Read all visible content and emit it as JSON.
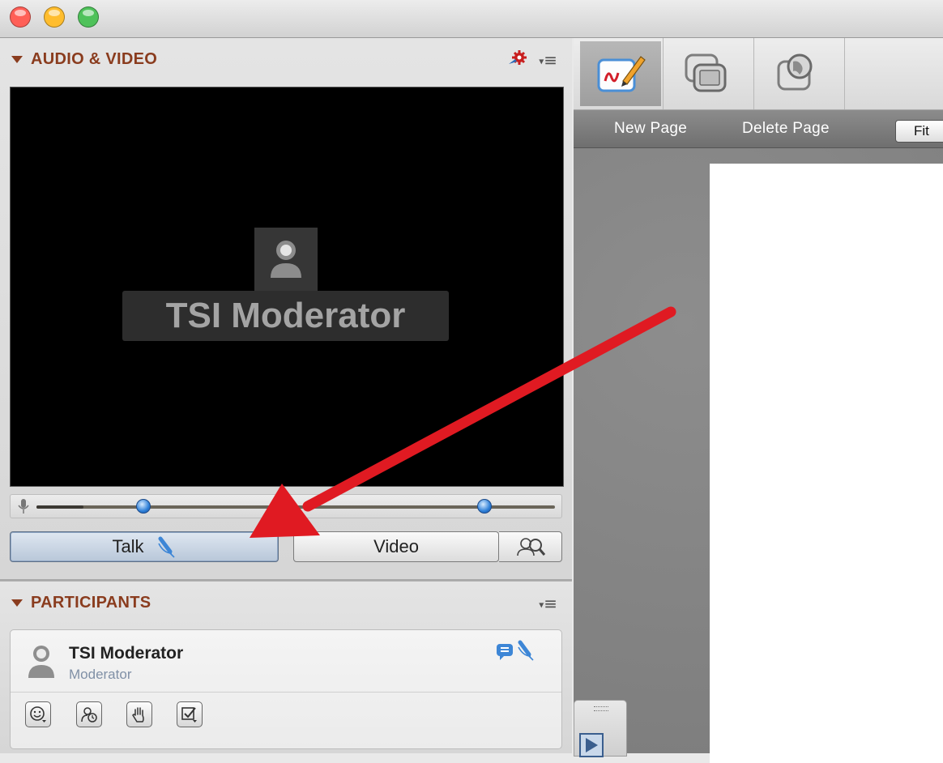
{
  "audio_video": {
    "title": "AUDIO & VIDEO",
    "menu_icon": "≡",
    "video_name": "TSI Moderator",
    "talk_label": "Talk",
    "video_label": "Video"
  },
  "participants": {
    "title": "PARTICIPANTS",
    "menu_icon": "≡",
    "items": [
      {
        "name": "TSI Moderator",
        "role": "Moderator"
      }
    ]
  },
  "whiteboard": {
    "new_page_label": "New Page",
    "delete_page_label": "Delete Page",
    "fit_label": "Fit"
  },
  "sliders": {
    "mic_level": 0.12,
    "mic_volume": 0.24,
    "speaker_volume": 0.88
  },
  "colors": {
    "close": "#ff5f57",
    "minimize": "#ffbd2e",
    "zoom": "#27c93f",
    "section_title": "#8a3c1e",
    "annotation_arrow": "#e01a22",
    "role_text": "#8090a6"
  },
  "icons": {
    "settings": "gear-icon",
    "talk": "microphone-icon",
    "zoom": "magnify-person-icon",
    "whiteboard": "whiteboard-pen-icon",
    "share": "screen-share-icon",
    "web": "globe-icon"
  }
}
